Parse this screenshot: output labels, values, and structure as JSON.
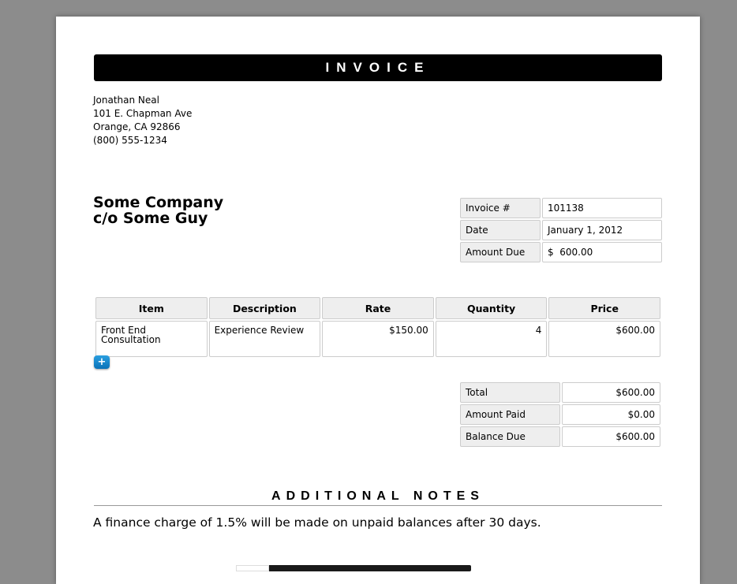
{
  "header": {
    "title": "INVOICE"
  },
  "sender": {
    "name": "Jonathan Neal",
    "street": "101 E. Chapman Ave",
    "city": "Orange, CA 92866",
    "phone": "(800) 555-1234"
  },
  "recipient": {
    "line1": "Some Company",
    "line2": "c/o Some Guy"
  },
  "meta": {
    "invoice_label": "Invoice #",
    "invoice_value": "101138",
    "date_label": "Date",
    "date_value": "January 1, 2012",
    "amount_label": "Amount Due",
    "amount_currency": "$",
    "amount_value": "600.00"
  },
  "items": {
    "headers": [
      "Item",
      "Description",
      "Rate",
      "Quantity",
      "Price"
    ],
    "rows": [
      {
        "item": "Front End Consultation",
        "description": "Experience Review",
        "rate": "$150.00",
        "quantity": "4",
        "price": "$600.00"
      }
    ],
    "add_label": "+"
  },
  "totals": {
    "total_label": "Total",
    "total_value": "$600.00",
    "paid_label": "Amount Paid",
    "paid_value": "$0.00",
    "balance_label": "Balance Due",
    "balance_value": "$600.00"
  },
  "notes": {
    "heading": "ADDITIONAL NOTES",
    "text": "A finance charge of 1.5% will be made on unpaid balances after 30 days."
  }
}
